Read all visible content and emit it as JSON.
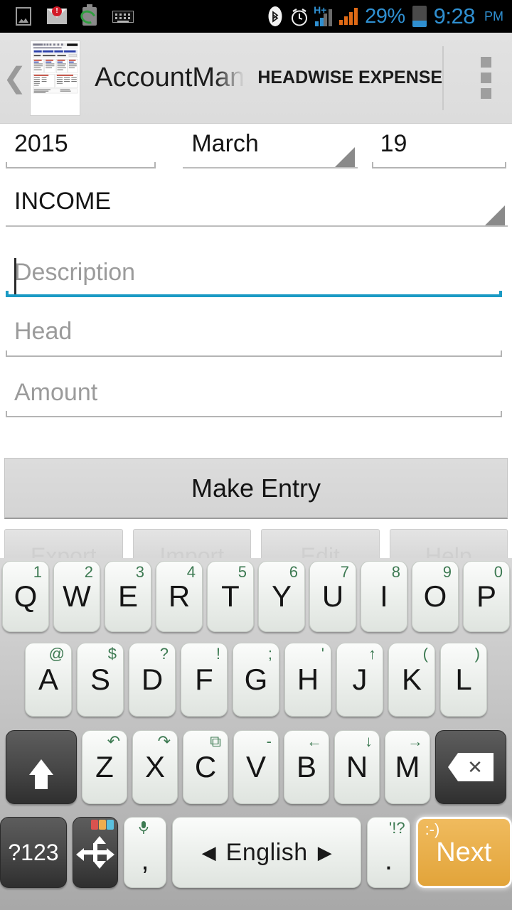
{
  "status_bar": {
    "left_icons": [
      "gallery-icon",
      "mail-icon",
      "battery-sync-icon",
      "keyboard-icon"
    ],
    "mail_badge": "!",
    "bluetooth_icon": "bluetooth-icon",
    "alarm_icon": "alarm-icon",
    "network_type": "H+",
    "battery_percent": "29%",
    "time": "9:28",
    "am_pm": "PM",
    "accent_color": "#2f8fd0",
    "signal_orange": "#e06a16"
  },
  "action_bar": {
    "back_glyph": "❮",
    "app_icon": "spreadsheet-thumbnail",
    "title": "AccountMan",
    "subtitle": "HEADWISE EXPENSE",
    "overflow_glyph": "overflow-menu"
  },
  "form": {
    "year": {
      "value": "2015",
      "name": "year-field"
    },
    "month": {
      "value": "March",
      "name": "month-spinner"
    },
    "day": {
      "value": "19",
      "name": "day-field"
    },
    "type": {
      "value": "INCOME",
      "name": "type-spinner"
    },
    "description": {
      "placeholder": "Description",
      "value": "",
      "focused": true
    },
    "head": {
      "placeholder": "Head",
      "value": ""
    },
    "amount": {
      "placeholder": "Amount",
      "value": ""
    },
    "focus_color": "#1a9ac4"
  },
  "buttons": {
    "make_entry": "Make Entry",
    "secondary": [
      "Export",
      "Import",
      "Edit",
      "Help"
    ]
  },
  "keyboard": {
    "row1": [
      {
        "main": "Q",
        "sec": "1"
      },
      {
        "main": "W",
        "sec": "2"
      },
      {
        "main": "E",
        "sec": "3"
      },
      {
        "main": "R",
        "sec": "4"
      },
      {
        "main": "T",
        "sec": "5"
      },
      {
        "main": "Y",
        "sec": "6"
      },
      {
        "main": "U",
        "sec": "7"
      },
      {
        "main": "I",
        "sec": "8"
      },
      {
        "main": "O",
        "sec": "9"
      },
      {
        "main": "P",
        "sec": "0"
      }
    ],
    "row2": [
      {
        "main": "A",
        "sec": "@"
      },
      {
        "main": "S",
        "sec": "$"
      },
      {
        "main": "D",
        "sec": "?"
      },
      {
        "main": "F",
        "sec": "!"
      },
      {
        "main": "G",
        "sec": ";"
      },
      {
        "main": "H",
        "sec": "'"
      },
      {
        "main": "J",
        "sec": "↑"
      },
      {
        "main": "K",
        "sec": "("
      },
      {
        "main": "L",
        "sec": ")"
      }
    ],
    "row3": [
      {
        "main": "Z",
        "sec": "↶"
      },
      {
        "main": "X",
        "sec": "↷"
      },
      {
        "main": "C",
        "sec": "⧉"
      },
      {
        "main": "V",
        "sec": "-"
      },
      {
        "main": "B",
        "sec": "←"
      },
      {
        "main": "N",
        "sec": "↓"
      },
      {
        "main": "M",
        "sec": "→"
      }
    ],
    "shift_label": "shift-icon",
    "backspace_label": "backspace-icon",
    "symbols_key": "?123",
    "nav_key": "cursor-arrows-icon",
    "comma_key": ",",
    "comma_sec": "mic-icon",
    "space_label": "English",
    "space_left_glyph": "◀",
    "space_right_glyph": "▶",
    "period_key": ".",
    "period_sec": "'!?",
    "next_key": "Next",
    "next_sec": ":-)",
    "next_color": "#e2a43a"
  }
}
